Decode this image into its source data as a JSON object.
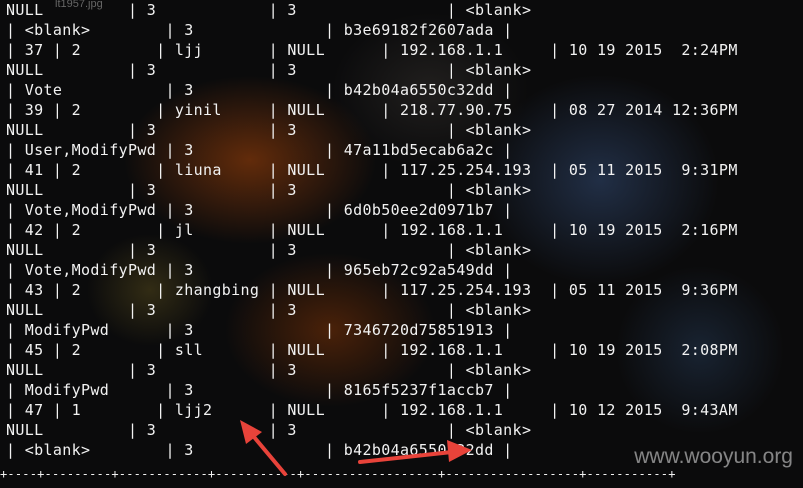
{
  "terminal": {
    "lines": [
      "NULL         | 3            | 3                | <blank>",
      "| <blank>        | 3              | b3e69182f2607ada |",
      "| 37 | 2        | ljj       | NULL      | 192.168.1.1     | 10 19 2015  2:24PM",
      "NULL         | 3            | 3                | <blank>",
      "| Vote           | 3              | b42b04a6550c32dd |",
      "| 39 | 2        | yinil     | NULL      | 218.77.90.75    | 08 27 2014 12:36PM",
      "NULL         | 3            | 3                | <blank>",
      "| User,ModifyPwd | 3              | 47a11bd5ecab6a2c |",
      "| 41 | 2        | liuna     | NULL      | 117.25.254.193  | 05 11 2015  9:31PM",
      "NULL         | 3            | 3                | <blank>",
      "| Vote,ModifyPwd | 3              | 6d0b50ee2d0971b7 |",
      "| 42 | 2        | jl        | NULL      | 192.168.1.1     | 10 19 2015  2:16PM",
      "NULL         | 3            | 3                | <blank>",
      "| Vote,ModifyPwd | 3              | 965eb72c92a549dd |",
      "| 43 | 2        | zhangbing | NULL      | 117.25.254.193  | 05 11 2015  9:36PM",
      "NULL         | 3            | 3                | <blank>",
      "| ModifyPwd      | 3              | 7346720d75851913 |",
      "| 45 | 2        | sll       | NULL      | 192.168.1.1     | 10 19 2015  2:08PM",
      "NULL         | 3            | 3                | <blank>",
      "| ModifyPwd      | 3              | 8165f5237f1accb7 |",
      "| 47 | 1        | ljj2      | NULL      | 192.168.1.1     | 10 12 2015  9:43AM",
      "NULL         | 3            | 3                | <blank>",
      "| <blank>        | 3              | b42b04a6550c32dd |"
    ],
    "separator": "+----+---------+------------+-----------+------------------+------------------+-----------+"
  },
  "watermark_top": "lt1957.jpg",
  "watermark": "www.wooyun.org",
  "annotation_color": "#e8433a"
}
